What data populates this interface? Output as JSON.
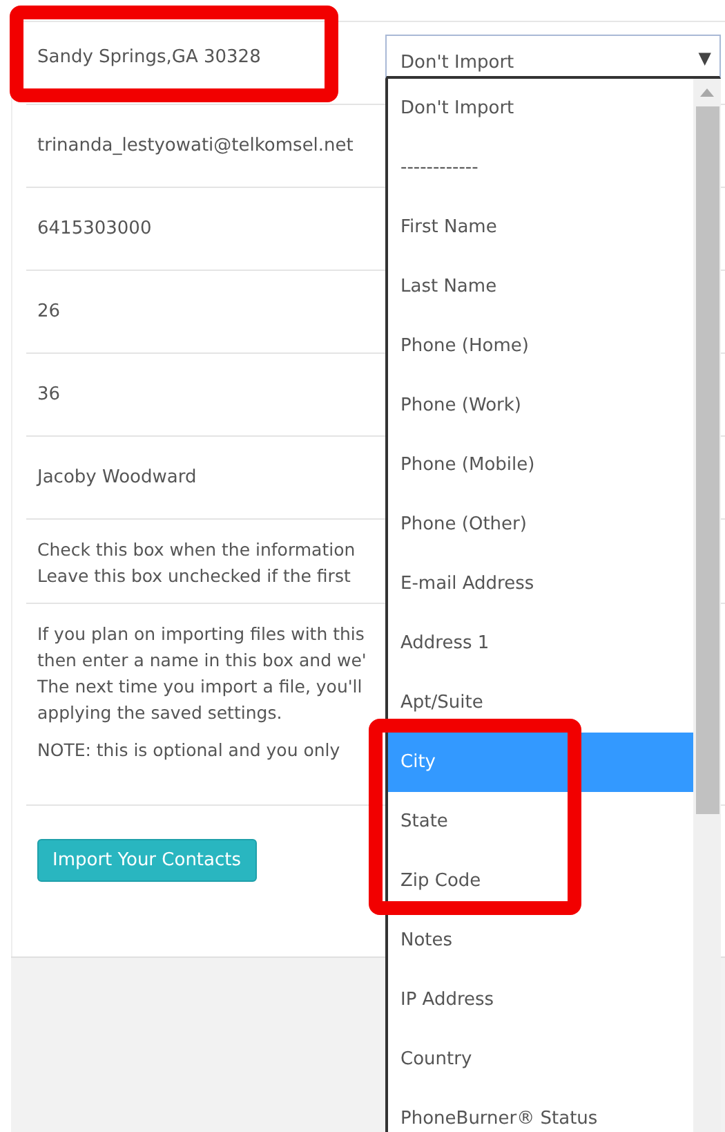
{
  "rows": [
    {
      "kind": "value",
      "text": "Sandy Springs,GA 30328",
      "highlighted": true
    },
    {
      "kind": "value",
      "text": "trinanda_lestyowati@telkomsel.net",
      "highlighted": false
    },
    {
      "kind": "value",
      "text": "6415303000",
      "highlighted": false
    },
    {
      "kind": "value",
      "text": "26",
      "highlighted": false
    },
    {
      "kind": "value",
      "text": "36",
      "highlighted": false
    },
    {
      "kind": "value",
      "text": "Jacoby Woodward",
      "highlighted": false
    }
  ],
  "help": [
    {
      "lines": [
        "Check this box when the information",
        "Leave this box unchecked if the first"
      ]
    },
    {
      "lines": [
        "If you plan on importing files with this",
        "then enter a name in this box and we'",
        "The next time you import a file, you'll",
        "applying the saved settings."
      ]
    },
    {
      "lines": [
        "NOTE: this is optional and you only"
      ]
    }
  ],
  "import_button": "Import Your Contacts",
  "select": {
    "value": "Don't Import",
    "arrow": "▼"
  },
  "options": [
    {
      "label": "Don't Import",
      "selected": false
    },
    {
      "label": "------------",
      "selected": false
    },
    {
      "label": "First Name",
      "selected": false
    },
    {
      "label": "Last Name",
      "selected": false
    },
    {
      "label": "Phone (Home)",
      "selected": false
    },
    {
      "label": "Phone (Work)",
      "selected": false
    },
    {
      "label": "Phone (Mobile)",
      "selected": false
    },
    {
      "label": "Phone (Other)",
      "selected": false
    },
    {
      "label": "E-mail Address",
      "selected": false
    },
    {
      "label": "Address 1",
      "selected": false
    },
    {
      "label": "Apt/Suite",
      "selected": false
    },
    {
      "label": "City",
      "selected": true,
      "framed": true
    },
    {
      "label": "State",
      "selected": false,
      "framed": true
    },
    {
      "label": "Zip Code",
      "selected": false,
      "framed": true
    },
    {
      "label": "Notes",
      "selected": false
    },
    {
      "label": "IP Address",
      "selected": false
    },
    {
      "label": "Country",
      "selected": false
    },
    {
      "label": "PhoneBurner® Status",
      "selected": false
    }
  ]
}
